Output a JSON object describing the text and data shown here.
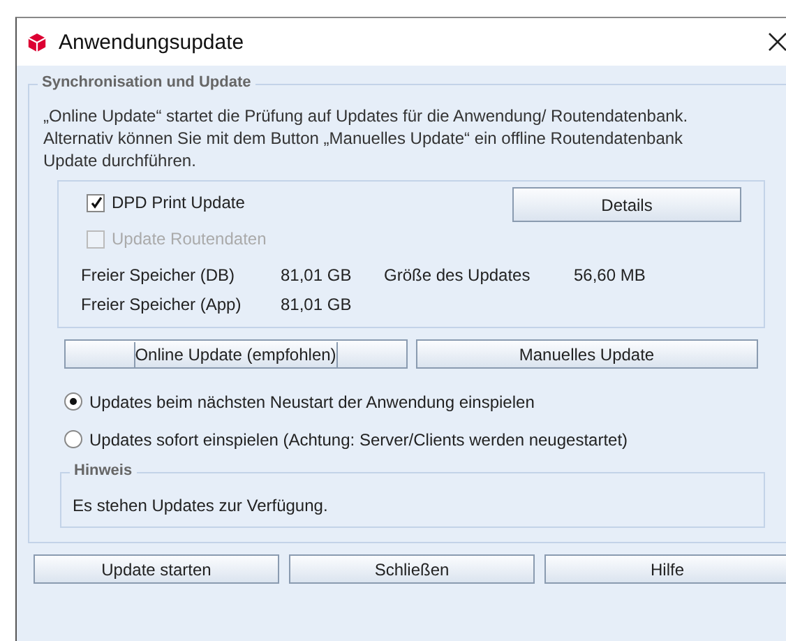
{
  "window": {
    "title": "Anwendungsupdate"
  },
  "sync_group": {
    "title": "Synchronisation und Update",
    "description": "„Online Update“ startet die Prüfung auf Updates für die Anwendung/ Routendatenbank. Alternativ können Sie mit dem Button „Manuelles Update“ ein offline Routendatenbank Update durchführen.",
    "checkboxes": [
      {
        "label": "DPD Print Update",
        "checked": true,
        "disabled": false
      },
      {
        "label": "Update Routendaten",
        "checked": false,
        "disabled": true
      }
    ],
    "details_button": "Details",
    "info_rows": [
      {
        "label": "Freier Speicher (DB)",
        "value": "81,01 GB",
        "extra_label": "Größe des Updates",
        "extra_value": "56,60 MB"
      },
      {
        "label": "Freier Speicher (App)",
        "value": "81,01 GB"
      }
    ],
    "update_buttons": [
      {
        "label": "Online Update (empfohlen)",
        "focused": true
      },
      {
        "label": "Manuelles Update",
        "focused": false
      }
    ],
    "radios": [
      {
        "label": "Updates beim nächsten Neustart der Anwendung einspielen",
        "selected": true
      },
      {
        "label": "Updates sofort einspielen (Achtung: Server/Clients werden neugestartet)",
        "selected": false
      }
    ],
    "hint": {
      "title": "Hinweis",
      "text": "Es stehen Updates zur Verfügung."
    }
  },
  "buttons": [
    "Update starten",
    "Schließen",
    "Hilfe"
  ]
}
